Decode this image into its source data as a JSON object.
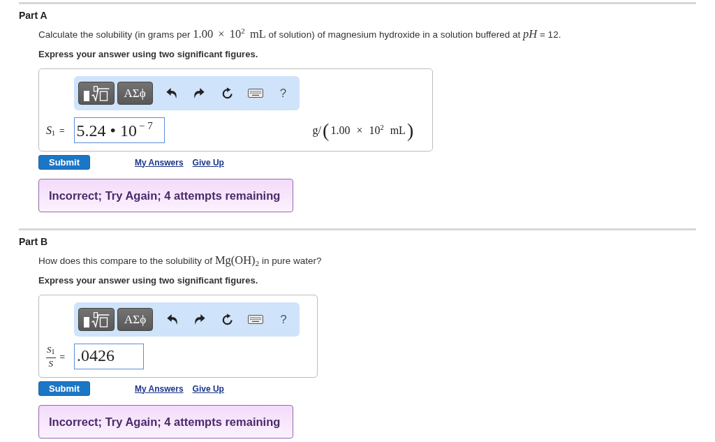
{
  "parts": [
    {
      "title": "Part A",
      "question": [
        {
          "kind": "text",
          "text": "Calculate the solubility (in grams per "
        },
        {
          "kind": "math",
          "text": "1.00 × 10$^{2}$ mL"
        },
        {
          "kind": "text",
          "text": " of solution) of magnesium hydroxide in a solution buffered at "
        },
        {
          "kind": "math",
          "text": "*pH*"
        },
        {
          "kind": "text",
          "text": " = 12."
        }
      ],
      "instruction": "Express your answer using two significant figures.",
      "toolbar": [
        {
          "kind": "template"
        },
        {
          "kind": "symbols",
          "label": "ΑΣϕ"
        },
        {
          "kind": "undo"
        },
        {
          "kind": "redo"
        },
        {
          "kind": "reset"
        },
        {
          "kind": "keyboard"
        },
        {
          "kind": "help",
          "label": "?"
        }
      ],
      "answer": {
        "label": {
          "kind": "variable",
          "text": "*S*$_{1}$"
        },
        "equals": "=",
        "value": "5.24 • 10$^{− 7}$",
        "units": [
          {
            "kind": "text",
            "text": "g/"
          },
          {
            "kind": "delim",
            "text": "("
          },
          {
            "kind": "text",
            "text": "1.00 × 10$^{2}$ mL"
          },
          {
            "kind": "delim",
            "text": ")"
          }
        ]
      },
      "submit": "Submit",
      "links": [
        "My Answers",
        "Give Up"
      ],
      "feedback": "Incorrect; Try Again; 4 attempts remaining"
    },
    {
      "title": "Part B",
      "question": [
        {
          "kind": "text",
          "text": "How does this compare to the solubility of "
        },
        {
          "kind": "math",
          "text": "Mg(OH)$_{2}$"
        },
        {
          "kind": "text",
          "text": " in pure water?"
        }
      ],
      "instruction": "Express your answer using two significant figures.",
      "toolbar": [
        {
          "kind": "template"
        },
        {
          "kind": "symbols",
          "label": "ΑΣϕ"
        },
        {
          "kind": "undo"
        },
        {
          "kind": "redo"
        },
        {
          "kind": "reset"
        },
        {
          "kind": "keyboard"
        },
        {
          "kind": "help",
          "label": "?"
        }
      ],
      "answer": {
        "label": {
          "kind": "fraction",
          "numerator": "*S*$_{1}$",
          "denominator": "*S*"
        },
        "equals": "=",
        "value": ".0426"
      },
      "submit": "Submit",
      "links": [
        "My Answers",
        "Give Up"
      ],
      "feedback": "Incorrect; Try Again; 4 attempts remaining"
    }
  ]
}
